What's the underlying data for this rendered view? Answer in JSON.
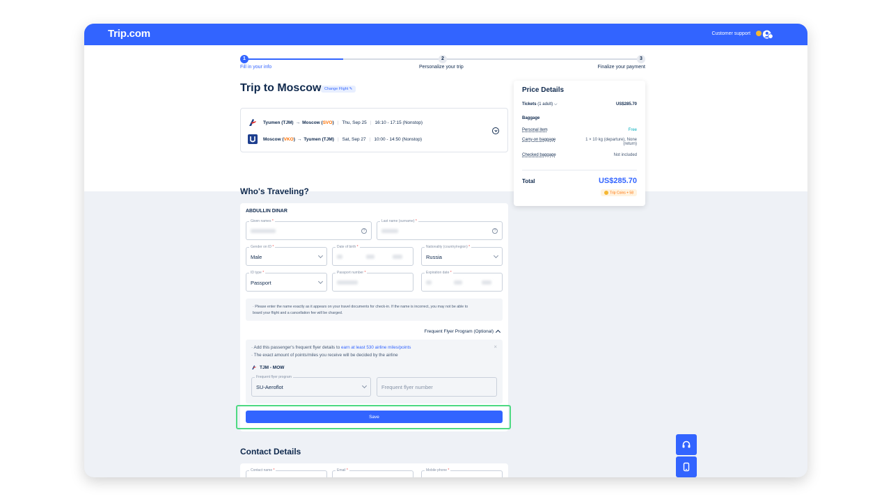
{
  "topbar": {
    "logo": "Trip.com",
    "support": "Customer support",
    "coins": "0"
  },
  "progress": {
    "steps": [
      {
        "num": "1",
        "label": "Fill in your info"
      },
      {
        "num": "2",
        "label": "Personalize your trip"
      },
      {
        "num": "3",
        "label": "Finalize your payment"
      }
    ]
  },
  "trip": {
    "title": "Trip to Moscow",
    "change_flight": "Change Flight"
  },
  "flights": [
    {
      "from": "Tyumen (TJM)",
      "arrow": "→",
      "to_prefix": "Moscow (",
      "to_code": "SVO",
      "to_suffix": ")",
      "date": "Thu, Sep 25",
      "time": "16:10 - 17:15 (Nonstop)"
    },
    {
      "from_prefix": "Moscow (",
      "from_code": "VKO",
      "from_suffix": ")",
      "arrow": "→",
      "to": "Tyumen (TJM)",
      "date": "Sat, Sep 27",
      "time": "10:00 - 14:50 (Nonstop)"
    }
  ],
  "price": {
    "title": "Price Details",
    "tickets_label": "Tickets",
    "tickets_qty": "(1 adult)",
    "tickets_amount": "US$285.70",
    "baggage_title": "Baggage",
    "personal_item": "Personal item",
    "personal_value": "Free",
    "carryon": "Carry-on baggage",
    "carryon_value_1": "1 × 10 kg (departure), None",
    "carryon_value_2": "(return)",
    "checked": "Checked baggage",
    "checked_value": "Not included",
    "total_label": "Total",
    "total_amount": "US$285.70",
    "trip_coins": "Trip Coins + 58"
  },
  "traveler": {
    "section_title": "Who's Traveling?",
    "name": "ABDULLIN DINAR",
    "given_names_label": "Given names",
    "last_name_label": "Last name (surname)",
    "gender_label": "Gender on ID",
    "gender_value": "Male",
    "dob_label": "Date of birth",
    "nationality_label": "Nationality (country/region)",
    "nationality_value": "Russia",
    "id_type_label": "ID type",
    "id_type_value": "Passport",
    "passport_label": "Passport number",
    "expiration_label": "Expiration date",
    "required_mark": "*",
    "notice_1": "· Please enter the name exactly as it appears on your travel documents for check-in. If the name is incorrect, you may not be able to",
    "notice_2": "board your flight and a cancellation fee will be charged.",
    "ffp_toggle": "Frequent Flyer Program (Optional)",
    "ffp_line1_prefix": "· Add this passenger's frequent flyer details to ",
    "ffp_line1_link": "earn at least 530 airline miles/points",
    "ffp_line2": "· The exact amount of points/miles you receive will be decided by the airline",
    "route": "TJM - MOW",
    "ffp_program_label": "Frequent flyer program",
    "ffp_program_value": "SU-Aeroflot",
    "ffp_number_placeholder": "Frequent flyer number",
    "save": "Save"
  },
  "contact": {
    "section_title": "Contact Details",
    "contact_name_label": "Contact name",
    "email_label": "Email",
    "mobile_label": "Mobile phone"
  },
  "colors": {
    "brand": "#3264ff",
    "accent_orange": "#ff6f00",
    "highlight": "#4dd982"
  },
  "icons": {
    "aeroflot": "aeroflot-logo-icon",
    "utair": "utair-logo-icon",
    "support": "headset-icon",
    "app": "phone-icon"
  }
}
